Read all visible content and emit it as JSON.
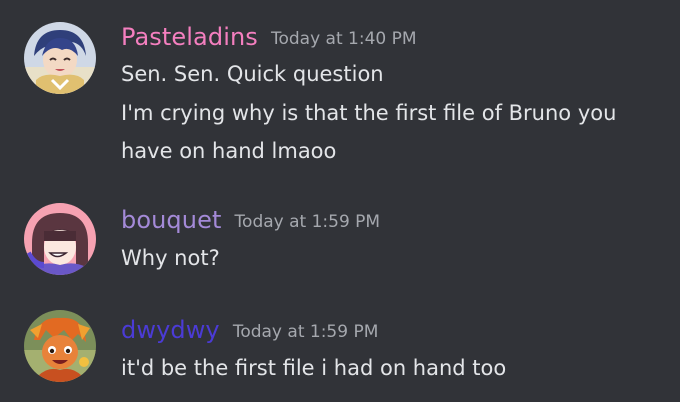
{
  "messages": [
    {
      "username": "Pasteladins",
      "username_color": "#f47fbf",
      "timestamp": "Today at 1:40 PM",
      "lines": [
        "Sen. Sen. Quick question",
        "I'm crying why is that the first file of Bruno you",
        "have on hand lmaoo"
      ]
    },
    {
      "username": "bouquet",
      "username_color": "#a48ad8",
      "timestamp": "Today at 1:59 PM",
      "lines": [
        "Why not?"
      ]
    },
    {
      "username": "dwydwy",
      "username_color": "#4b3bd6",
      "timestamp": "Today at 1:59 PM",
      "lines": [
        "it'd be the first file i had on hand too"
      ]
    }
  ]
}
